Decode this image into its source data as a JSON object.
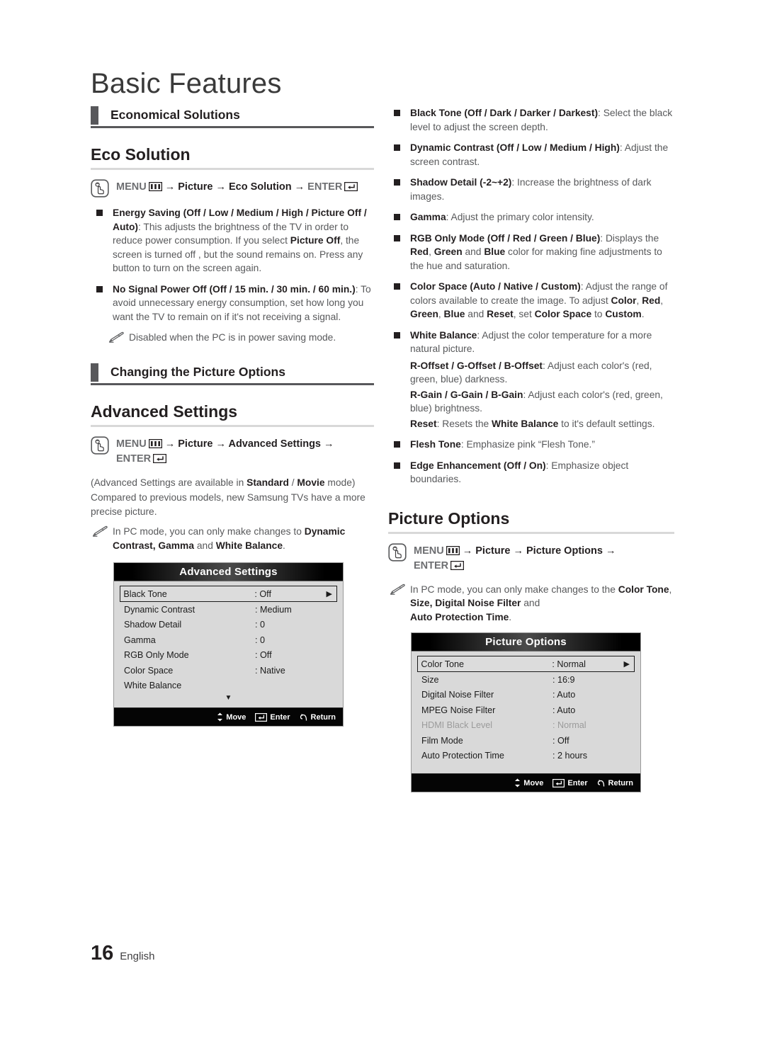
{
  "page": {
    "title": "Basic Features",
    "number": "16",
    "language": "English"
  },
  "icons": {
    "hand": "hand-press-icon",
    "pencil": "note-pencil-icon",
    "menu_glyph": "menu-bars-icon",
    "enter_glyph": "enter-return-icon",
    "right_arrow": "▶",
    "down_arrow": "▼",
    "updown_arrow": "↕"
  },
  "left_column": {
    "section_1": {
      "label": "Economical Solutions"
    },
    "feature_1": {
      "heading": "Eco Solution",
      "menu_path": [
        "MENU",
        "Picture",
        "Eco  Solution",
        "ENTER"
      ],
      "bullets": [
        {
          "title": "Energy Saving (Off / Low / Medium / High / Picture Off / Auto)",
          "body": ": This adjusts the brightness of the TV in order to reduce power consumption. If you select Picture Off, the screen is turned off , but the sound remains on. Press any button to turn on the screen again.",
          "bold_inline": [
            "Picture Off"
          ]
        },
        {
          "title": "No Signal Power Off (Off / 15 min. / 30 min. / 60 min.)",
          "body": ": To avoid unnecessary energy consumption, set how long you want the TV to remain on if it's not receiving a signal."
        }
      ],
      "note": "Disabled when the PC is in power saving mode."
    },
    "section_2": {
      "label": "Changing the Picture Options"
    },
    "feature_2": {
      "heading": "Advanced Settings",
      "menu_path": [
        "MENU",
        "Picture",
        "Advanced Settings",
        "ENTER"
      ],
      "paragraph_1_pre": "(Advanced Settings are available in ",
      "paragraph_1_b1": "Standard",
      "paragraph_1_mid": " / ",
      "paragraph_1_b2": "Movie",
      "paragraph_1_post": " mode)",
      "paragraph_2": "Compared to previous models, new Samsung TVs have a more precise picture.",
      "note_pre": "In PC mode, you can only make changes to ",
      "note_b1": "Dynamic Contrast, Gamma",
      "note_mid": " and ",
      "note_b2": "White Balance",
      "note_post": "."
    },
    "osd_advanced": {
      "title": "Advanced Settings",
      "rows": [
        {
          "label": "Black Tone",
          "value": ": Off",
          "selected": true,
          "dim": false,
          "arrow": "▶"
        },
        {
          "label": "Dynamic Contrast",
          "value": ": Medium",
          "selected": false,
          "dim": false
        },
        {
          "label": "Shadow Detail",
          "value": ": 0",
          "selected": false,
          "dim": false
        },
        {
          "label": "Gamma",
          "value": ": 0",
          "selected": false,
          "dim": false
        },
        {
          "label": "RGB Only Mode",
          "value": ": Off",
          "selected": false,
          "dim": false
        },
        {
          "label": "Color Space",
          "value": ": Native",
          "selected": false,
          "dim": false
        },
        {
          "label": "White Balance",
          "value": "",
          "selected": false,
          "dim": false
        }
      ],
      "scroll_indicator": "▼",
      "footer": {
        "move": "Move",
        "enter": "Enter",
        "return": "Return"
      }
    }
  },
  "right_column": {
    "bullets_advanced": [
      {
        "title": "Black Tone (Off / Dark / Darker / Darkest)",
        "body": ": Select the black level to adjust the screen depth."
      },
      {
        "title": "Dynamic Contrast (Off / Low / Medium / High)",
        "body": ": Adjust the screen contrast."
      },
      {
        "title": "Shadow Detail (-2~+2)",
        "body": ": Increase the brightness of dark images."
      },
      {
        "title": "Gamma",
        "body": ": Adjust the primary color intensity."
      },
      {
        "title": "RGB Only Mode (Off / Red / Green / Blue)",
        "body": ": Displays the Red, Green and Blue color for making fine adjustments to the hue and saturation."
      },
      {
        "title": "Color Space (Auto / Native / Custom)",
        "body": ": Adjust the range of colors available to create the image. To adjust Color, Red, Green, Blue and Reset, set Color Space to Custom."
      },
      {
        "title": "White Balance",
        "body": ": Adjust the color temperature for a more natural picture."
      }
    ],
    "white_balance_sub": [
      {
        "title": "R-Offset / G-Offset / B-Offset",
        "body": ": Adjust each color's (red, green, blue) darkness."
      },
      {
        "title": "R-Gain / G-Gain / B-Gain",
        "body": ": Adjust each color's (red, green, blue) brightness."
      },
      {
        "title": "Reset",
        "body_pre": ": Resets the ",
        "body_b": "White Balance",
        "body_post": " to it's default settings."
      }
    ],
    "bullets_tail": [
      {
        "title": "Flesh Tone",
        "body": ": Emphasize pink “Flesh Tone.”"
      },
      {
        "title": "Edge Enhancement (Off / On)",
        "body": ": Emphasize object boundaries."
      }
    ],
    "feature_3": {
      "heading": "Picture Options",
      "menu_path": [
        "MENU",
        "Picture",
        "Picture Options",
        "ENTER"
      ],
      "note_pre": "In PC mode, you can only make changes to the ",
      "note_b1": "Color Tone",
      "note_c1": ", ",
      "note_b2": "Size, Digital Noise Filter",
      "note_mid": " and ",
      "note_b3": "Auto Protection Time",
      "note_post": "."
    },
    "osd_picture_options": {
      "title": "Picture Options",
      "rows": [
        {
          "label": "Color Tone",
          "value": ": Normal",
          "selected": true,
          "dim": false,
          "arrow": "▶"
        },
        {
          "label": "Size",
          "value": ": 16:9",
          "selected": false,
          "dim": false
        },
        {
          "label": "Digital Noise Filter",
          "value": ": Auto",
          "selected": false,
          "dim": false
        },
        {
          "label": "MPEG Noise Filter",
          "value": ": Auto",
          "selected": false,
          "dim": false
        },
        {
          "label": "HDMI Black Level",
          "value": ": Normal",
          "selected": false,
          "dim": true
        },
        {
          "label": "Film Mode",
          "value": ": Off",
          "selected": false,
          "dim": false
        },
        {
          "label": "Auto Protection Time",
          "value": ": 2 hours",
          "selected": false,
          "dim": false
        }
      ],
      "footer": {
        "move": "Move",
        "enter": "Enter",
        "return": "Return"
      }
    }
  },
  "colors": {
    "ink": "#231f20",
    "body_gray": "#58595b",
    "tab_gray": "#58585b",
    "light_rule": "#d8d8d8",
    "osd_bg": "#d9d9d9"
  }
}
